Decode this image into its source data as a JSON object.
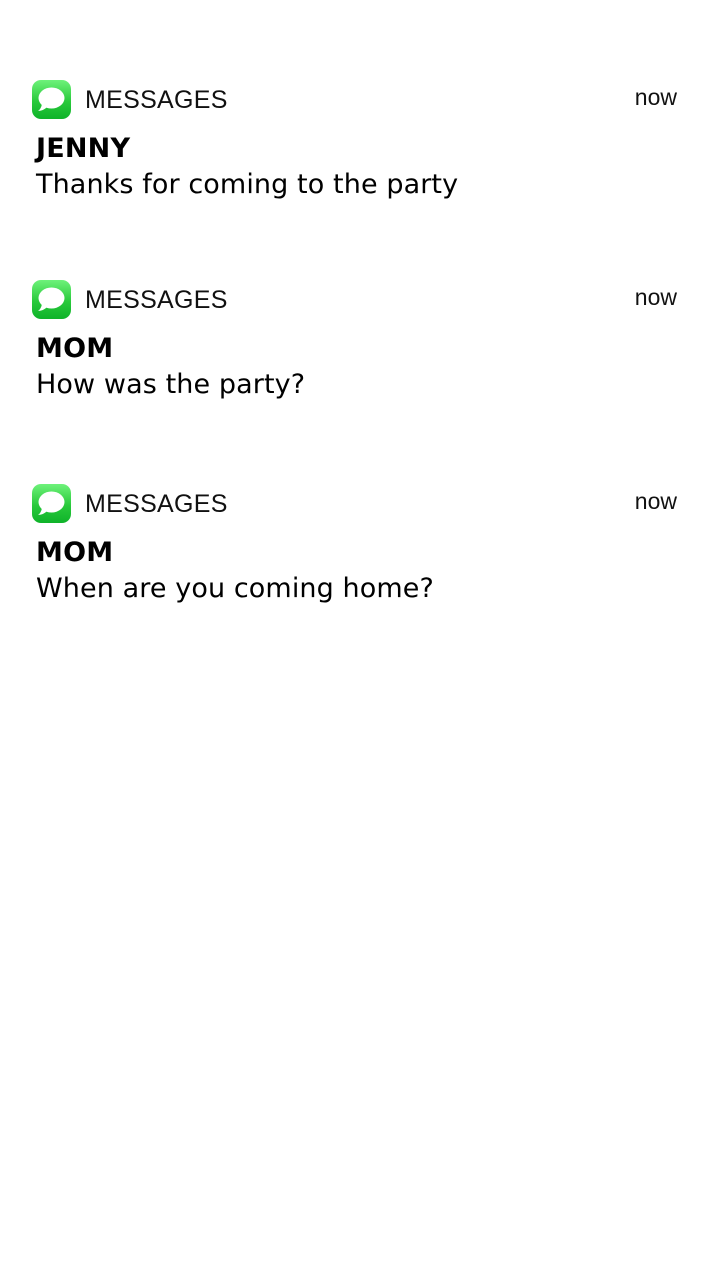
{
  "notifications": [
    {
      "app_icon": "messages-icon",
      "app_name": "MESSAGES",
      "time": "now",
      "sender": "JENNY",
      "message": "Thanks for coming to the party"
    },
    {
      "app_icon": "messages-icon",
      "app_name": "MESSAGES",
      "time": "now",
      "sender": "MOM",
      "message": "How was the party?"
    },
    {
      "app_icon": "messages-icon",
      "app_name": "MESSAGES",
      "time": "now",
      "sender": "MOM",
      "message": "When are you coming home?"
    }
  ],
  "colors": {
    "background": "#ffffff",
    "icon_green": "#29c93b",
    "text": "#000000"
  }
}
